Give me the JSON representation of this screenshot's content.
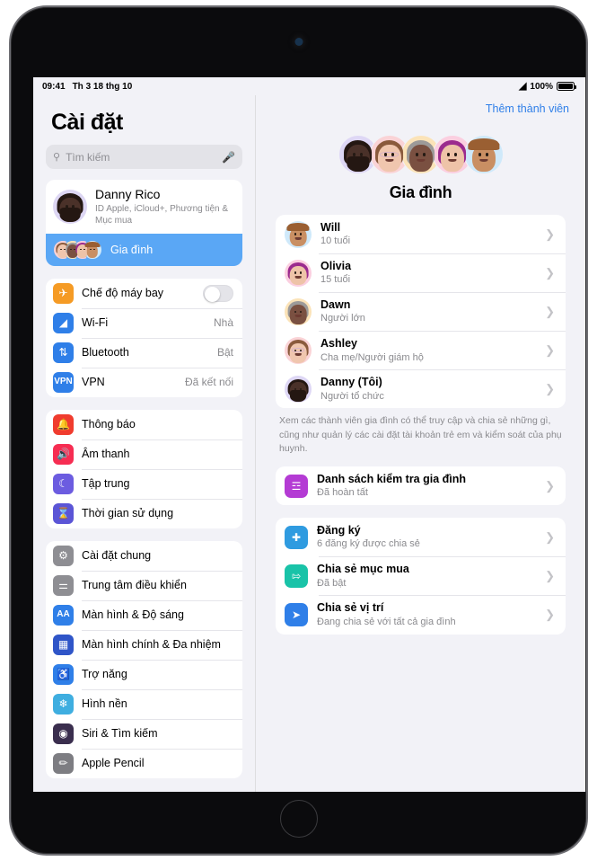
{
  "status_bar": {
    "time": "09:41",
    "date": "Th 3 18 thg 10",
    "wifi_icon": "wifi-icon",
    "battery_percent": "100%",
    "battery_icon": "battery-full-icon"
  },
  "sidebar": {
    "title": "Cài đặt",
    "search": {
      "placeholder": "Tìm kiếm",
      "search_icon": "search-icon",
      "dictation_icon": "microphone-icon"
    },
    "profile": {
      "name": "Danny Rico",
      "subtitle": "ID Apple, iCloud+, Phương tiện & Mục mua",
      "avatar_icon": "memoji-danny-avatar"
    },
    "family_item": {
      "label": "Gia đình",
      "selected": true,
      "avatars_icon": "family-memoji-stack"
    },
    "groups": [
      {
        "items": [
          {
            "label": "Chế độ máy bay",
            "value": "",
            "icon": "airplane-icon",
            "icon_color": "#F59B25",
            "control": "toggle",
            "toggle_on": false
          },
          {
            "label": "Wi-Fi",
            "value": "Nhà",
            "icon": "wifi-icon",
            "icon_color": "#2F7FE8"
          },
          {
            "label": "Bluetooth",
            "value": "Bật",
            "icon": "bluetooth-icon",
            "icon_color": "#2F7FE8"
          },
          {
            "label": "VPN",
            "value": "Đã kết nối",
            "icon": "vpn-icon",
            "icon_color": "#2F7FE8"
          }
        ]
      },
      {
        "items": [
          {
            "label": "Thông báo",
            "value": "",
            "icon": "bell-icon",
            "icon_color": "#F03C2E"
          },
          {
            "label": "Âm thanh",
            "value": "",
            "icon": "speaker-icon",
            "icon_color": "#F62D52"
          },
          {
            "label": "Tập trung",
            "value": "",
            "icon": "moon-icon",
            "icon_color": "#6C5CE0"
          },
          {
            "label": "Thời gian sử dụng",
            "value": "",
            "icon": "hourglass-icon",
            "icon_color": "#5B55D6"
          }
        ]
      },
      {
        "items": [
          {
            "label": "Cài đặt chung",
            "value": "",
            "icon": "gear-icon",
            "icon_color": "#8E8E93"
          },
          {
            "label": "Trung tâm điều khiển",
            "value": "",
            "icon": "control-center-icon",
            "icon_color": "#8E8E93"
          },
          {
            "label": "Màn hình & Độ sáng",
            "value": "",
            "icon": "text-size-icon",
            "icon_color": "#2F7FE8"
          },
          {
            "label": "Màn hình chính & Đa nhiệm",
            "value": "",
            "icon": "home-screen-icon",
            "icon_color": "#2F55C8"
          },
          {
            "label": "Trợ năng",
            "value": "",
            "icon": "accessibility-icon",
            "icon_color": "#2F7FE8"
          },
          {
            "label": "Hình nền",
            "value": "",
            "icon": "wallpaper-icon",
            "icon_color": "#3FAEE0"
          },
          {
            "label": "Siri & Tìm kiếm",
            "value": "",
            "icon": "siri-icon",
            "icon_color": "#3A2E4E"
          },
          {
            "label": "Apple Pencil",
            "value": "",
            "icon": "pencil-icon",
            "icon_color": "#7D7D82"
          }
        ]
      }
    ]
  },
  "detail": {
    "add_member_label": "Thêm thành viên",
    "title": "Gia đình",
    "hero_avatars_icon": "family-memoji-row",
    "members": [
      {
        "name": "Will",
        "role": "10 tuổi",
        "avatar_icon": "memoji-will-avatar",
        "chevron_icon": "chevron-right-icon"
      },
      {
        "name": "Olivia",
        "role": "15 tuổi",
        "avatar_icon": "memoji-olivia-avatar",
        "chevron_icon": "chevron-right-icon"
      },
      {
        "name": "Dawn",
        "role": "Người lớn",
        "avatar_icon": "memoji-dawn-avatar",
        "chevron_icon": "chevron-right-icon"
      },
      {
        "name": "Ashley",
        "role": "Cha mẹ/Người giám hộ",
        "avatar_icon": "memoji-ashley-avatar",
        "chevron_icon": "chevron-right-icon"
      },
      {
        "name": "Danny (Tôi)",
        "role": "Người tổ chức",
        "avatar_icon": "memoji-danny-avatar",
        "chevron_icon": "chevron-right-icon"
      }
    ],
    "footnote": "Xem các thành viên gia đình có thể truy cập và chia sẻ những gì, cũng như quản lý các cài đặt tài khoản trẻ em và kiểm soát của phụ huynh.",
    "checklist": {
      "title": "Danh sách kiểm tra gia đình",
      "subtitle": "Đã hoàn tất",
      "icon": "checklist-icon",
      "icon_color": "#B43BD4",
      "chevron_icon": "chevron-right-icon"
    },
    "services": [
      {
        "title": "Đăng ký",
        "subtitle": "6 đăng ký được chia sẻ",
        "icon": "subscriptions-icon",
        "icon_color": "#2F9BE0",
        "chevron_icon": "chevron-right-icon"
      },
      {
        "title": "Chia sẻ mục mua",
        "subtitle": "Đã bật",
        "icon": "purchase-sharing-icon",
        "icon_color": "#19C3A8",
        "chevron_icon": "chevron-right-icon"
      },
      {
        "title": "Chia sẻ vị trí",
        "subtitle": "Đang chia sẻ với tất cả gia đình",
        "icon": "location-icon",
        "icon_color": "#2F7FE8",
        "chevron_icon": "chevron-right-icon"
      }
    ]
  },
  "avatar_styles": {
    "danny": {
      "bg": "#ded7f5",
      "skin": "#4a3129",
      "hair": "#241712",
      "beard": "#241712"
    },
    "ashley": {
      "bg": "#fad3d6",
      "skin": "#f0c6ae",
      "hair": "#8a5a3c",
      "glasses": true
    },
    "dawn": {
      "bg": "#fbe3b8",
      "skin": "#7a5041",
      "hair": "#9c9a99"
    },
    "olivia": {
      "bg": "#fbcfe0",
      "skin": "#eec3a8",
      "hair": "#9b2a8e"
    },
    "will": {
      "bg": "#cfe9fa",
      "skin": "#c98f63",
      "hair": "#7b4a23",
      "hat": "#9a5f32"
    }
  }
}
